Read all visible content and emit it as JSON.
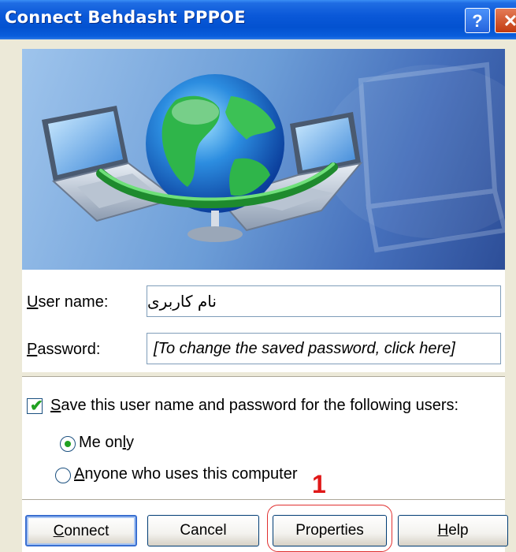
{
  "window": {
    "title": "Connect Behdasht PPPOE",
    "help_glyph": "?",
    "close_glyph": "✕"
  },
  "banner": {
    "icons": [
      "globe-icon",
      "laptop-icon",
      "laptop-icon"
    ]
  },
  "fields": {
    "username": {
      "label_accel": "U",
      "label_rest": "ser name:",
      "value": "نام کاربری"
    },
    "password": {
      "label_accel": "P",
      "label_rest": "assword:",
      "value": "[To change the saved password, click here]"
    }
  },
  "save_options": {
    "checkbox_label_accel": "S",
    "checkbox_label_rest": "ave this user name and password for the following users:",
    "checked": true,
    "radios": [
      {
        "label_pre": "Me on",
        "label_accel": "l",
        "label_post": "y",
        "selected": true
      },
      {
        "label_pre": "",
        "label_accel": "A",
        "label_post": "nyone who uses this computer",
        "selected": false
      }
    ]
  },
  "buttons": {
    "connect": {
      "accel": "C",
      "rest": "onnect"
    },
    "cancel": {
      "label": "Cancel"
    },
    "properties": {
      "label": "Properties"
    },
    "help": {
      "accel": "H",
      "rest": "elp"
    }
  },
  "annotation": {
    "number": "1",
    "color": "#E01818"
  },
  "colors": {
    "titlebar": "#0A58D8",
    "dialog_bg": "#ECE9D8",
    "button_border": "#003C74",
    "check_green": "#21A121"
  }
}
